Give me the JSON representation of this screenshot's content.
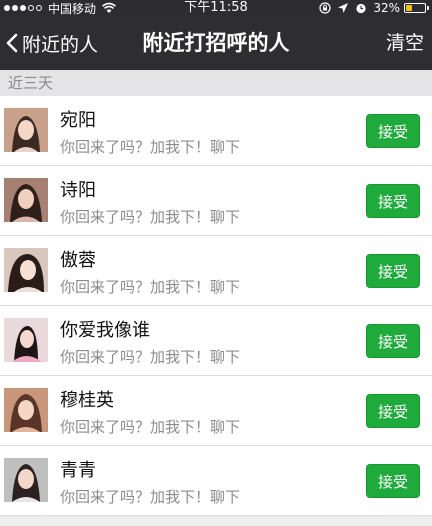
{
  "status_bar": {
    "carrier": "中国移动",
    "time": "下午11:58",
    "battery_percent": "32%",
    "battery_level": 0.32,
    "signal_full_dots": 3,
    "signal_total_dots": 5,
    "icons": [
      "wifi-icon",
      "lock-rotation-icon",
      "location-arrow-icon",
      "alarm-clock-icon"
    ]
  },
  "nav": {
    "back_label": "附近的人",
    "title": "附近打招呼的人",
    "right_label": "清空"
  },
  "section": {
    "label": "近三天"
  },
  "rows": [
    {
      "name": "宛阳",
      "message": "你回来了吗？加我下！聊下",
      "action": "接受"
    },
    {
      "name": "诗阳",
      "message": "你回来了吗？加我下！聊下",
      "action": "接受"
    },
    {
      "name": "傲蓉",
      "message": "你回来了吗？加我下！聊下",
      "action": "接受"
    },
    {
      "name": "你爱我像谁",
      "message": "你回来了吗？加我下！聊下",
      "action": "接受"
    },
    {
      "name": "穆桂英",
      "message": "你回来了吗？加我下！聊下",
      "action": "接受"
    },
    {
      "name": "青青",
      "message": "你回来了吗？加我下！聊下",
      "action": "接受"
    }
  ],
  "colors": {
    "bar_background": "#2e2e32",
    "accent_green": "#1faa3c",
    "battery_yellow": "#f2c01d"
  }
}
